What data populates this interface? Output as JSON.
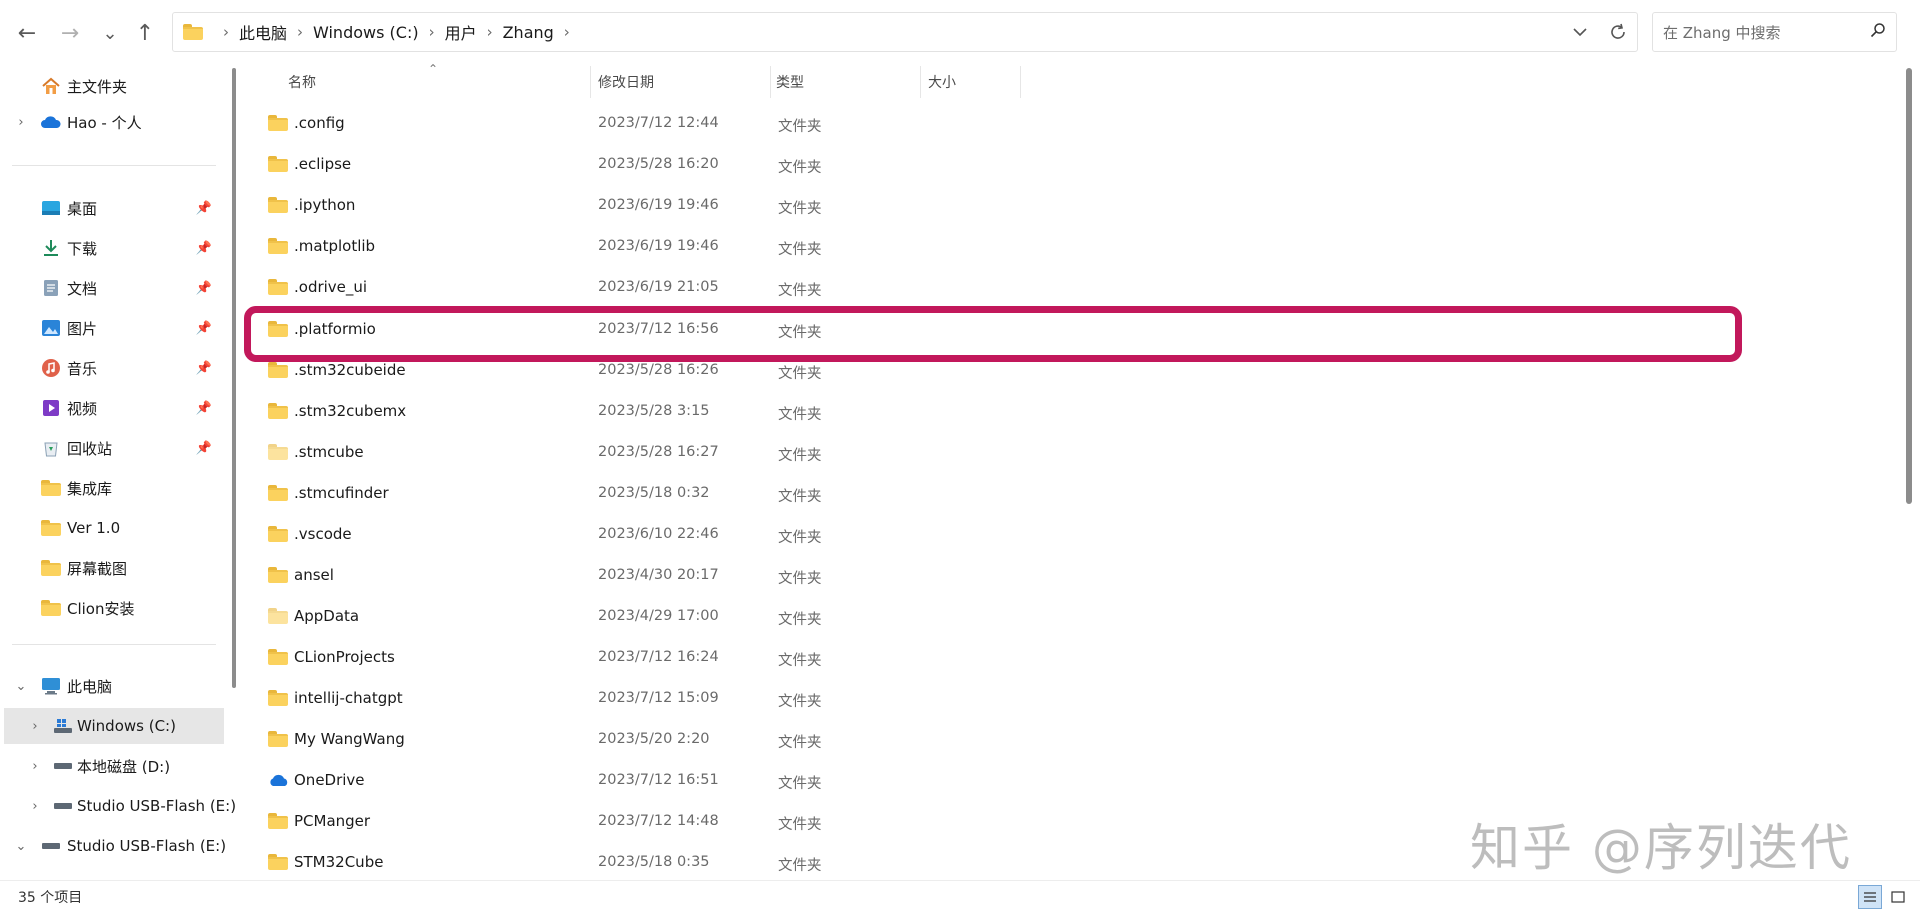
{
  "toolbar": {
    "back_icon": "←",
    "forward_icon": "→",
    "recent_icon": "⌄",
    "up_icon": "↑"
  },
  "address": {
    "crumbs": [
      "此电脑",
      "Windows (C:)",
      "用户",
      "Zhang"
    ],
    "separator": "›"
  },
  "search": {
    "placeholder": "在 Zhang 中搜索"
  },
  "sidebar": {
    "items": [
      {
        "label": "主文件夹",
        "icon": "home-icon"
      },
      {
        "label": "Hao - 个人",
        "icon": "onedrive-icon"
      },
      {
        "label": "桌面",
        "icon": "desktop-icon"
      },
      {
        "label": "下载",
        "icon": "download-icon"
      },
      {
        "label": "文档",
        "icon": "documents-icon"
      },
      {
        "label": "图片",
        "icon": "pictures-icon"
      },
      {
        "label": "音乐",
        "icon": "music-icon"
      },
      {
        "label": "视频",
        "icon": "videos-icon"
      },
      {
        "label": "回收站",
        "icon": "recycle-bin-icon"
      },
      {
        "label": "集成库",
        "icon": "folder-icon"
      },
      {
        "label": "Ver 1.0",
        "icon": "folder-icon"
      },
      {
        "label": "屏幕截图",
        "icon": "folder-icon"
      },
      {
        "label": "Clion安装",
        "icon": "folder-icon"
      },
      {
        "label": "此电脑",
        "icon": "this-pc-icon"
      },
      {
        "label": "Windows (C:)",
        "icon": "windows-drive-icon"
      },
      {
        "label": "本地磁盘 (D:)",
        "icon": "drive-icon"
      },
      {
        "label": "Studio USB-Flash (E:)",
        "icon": "drive-icon"
      },
      {
        "label": "Studio USB-Flash (E:)",
        "icon": "drive-icon"
      }
    ]
  },
  "columns": {
    "name": "名称",
    "date": "修改日期",
    "type": "类型",
    "size": "大小"
  },
  "files": [
    {
      "name": ".config",
      "date": "2023/7/12 12:44",
      "type": "文件夹"
    },
    {
      "name": ".eclipse",
      "date": "2023/5/28 16:20",
      "type": "文件夹"
    },
    {
      "name": ".ipython",
      "date": "2023/6/19 19:46",
      "type": "文件夹"
    },
    {
      "name": ".matplotlib",
      "date": "2023/6/19 19:46",
      "type": "文件夹"
    },
    {
      "name": ".odrive_ui",
      "date": "2023/6/19 21:05",
      "type": "文件夹"
    },
    {
      "name": ".platformio",
      "date": "2023/7/12 16:56",
      "type": "文件夹"
    },
    {
      "name": ".stm32cubeide",
      "date": "2023/5/28 16:26",
      "type": "文件夹"
    },
    {
      "name": ".stm32cubemx",
      "date": "2023/5/28 3:15",
      "type": "文件夹"
    },
    {
      "name": ".stmcube",
      "date": "2023/5/28 16:27",
      "type": "文件夹"
    },
    {
      "name": ".stmcufinder",
      "date": "2023/5/18 0:32",
      "type": "文件夹"
    },
    {
      "name": ".vscode",
      "date": "2023/6/10 22:46",
      "type": "文件夹"
    },
    {
      "name": "ansel",
      "date": "2023/4/30 20:17",
      "type": "文件夹"
    },
    {
      "name": "AppData",
      "date": "2023/4/29 17:00",
      "type": "文件夹"
    },
    {
      "name": "CLionProjects",
      "date": "2023/7/12 16:24",
      "type": "文件夹"
    },
    {
      "name": "intellij-chatgpt",
      "date": "2023/7/12 15:09",
      "type": "文件夹"
    },
    {
      "name": "My WangWang",
      "date": "2023/5/20 2:20",
      "type": "文件夹"
    },
    {
      "name": "OneDrive",
      "date": "2023/7/12 16:51",
      "type": "文件夹"
    },
    {
      "name": "PCManger",
      "date": "2023/7/12 14:48",
      "type": "文件夹"
    },
    {
      "name": "STM32Cube",
      "date": "2023/5/18 0:35",
      "type": "文件夹"
    }
  ],
  "watermark": "知乎 @序列迭代",
  "status": {
    "count": "35 个项目"
  },
  "colors": {
    "highlight": "#c2185b",
    "folder": "#fbd25e"
  }
}
